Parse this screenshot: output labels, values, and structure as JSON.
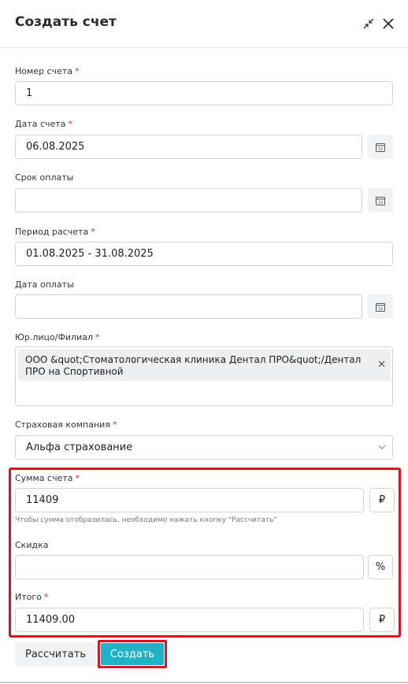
{
  "dialog": {
    "title": "Создать счет"
  },
  "fields": {
    "invoice_number": {
      "label": "Номер счета",
      "required": "*",
      "value": "1"
    },
    "invoice_date": {
      "label": "Дата счета",
      "required": "*",
      "value": "06.08.2025"
    },
    "payment_due": {
      "label": "Срок оплаты",
      "value": ""
    },
    "billing_period": {
      "label": "Период расчета",
      "required": "*",
      "value": "01.08.2025 - 31.08.2025"
    },
    "payment_date": {
      "label": "Дата оплаты",
      "value": ""
    },
    "legal_entity": {
      "label": "Юр.лицо/Филиал",
      "required": "*",
      "chip": "ООО &quot;Стоматологическая клиника Дентал ПРО&quot;/Дентал ПРО на Спортивной"
    },
    "insurance_company": {
      "label": "Страховая компания",
      "required": "*",
      "value": "Альфа страхование"
    },
    "invoice_sum": {
      "label": "Сумма счета",
      "required": "*",
      "value": "11409",
      "currency": "₽",
      "hint": "Чтобы сумма отобразилась, необходимо нажать кнопку \"Рассчитать\""
    },
    "discount": {
      "label": "Скидка",
      "value": "",
      "unit": "%"
    },
    "total": {
      "label": "Итого",
      "required": "*",
      "value": "11409.00",
      "currency": "₽"
    }
  },
  "buttons": {
    "calculate": "Рассчитать",
    "create": "Создать"
  },
  "icons": {
    "calendar_day": "19"
  },
  "colors": {
    "accent": "#1fb3c8",
    "highlight": "#e3101e",
    "required": "#d0312d"
  }
}
